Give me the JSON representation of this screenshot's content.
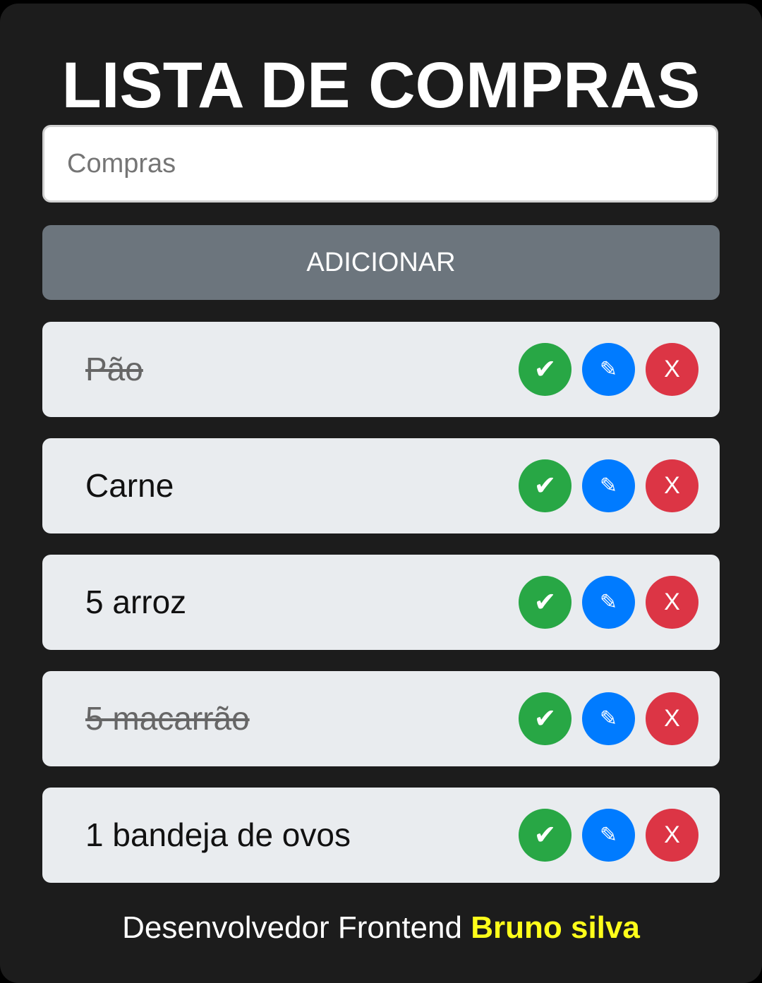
{
  "header": {
    "title": "LISTA DE COMPRAS"
  },
  "form": {
    "input_placeholder": "Compras",
    "input_value": "",
    "add_button_label": "ADICIONAR"
  },
  "items": [
    {
      "label": "Pão",
      "done": true
    },
    {
      "label": "Carne",
      "done": false
    },
    {
      "label": "5 arroz",
      "done": false
    },
    {
      "label": "5 macarrão",
      "done": true
    },
    {
      "label": "1 bandeja de ovos",
      "done": false
    }
  ],
  "item_actions": {
    "check_icon": "check-icon",
    "edit_icon": "pencil-icon",
    "delete_label": "X"
  },
  "footer": {
    "text": "Desenvolvedor Frontend",
    "author": "Bruno silva"
  },
  "colors": {
    "background": "#1c1c1c",
    "add_button": "#6c757d",
    "item_background": "#e9ecef",
    "check": "#28a745",
    "edit": "#007bff",
    "delete": "#dc3545",
    "author_highlight": "#ffff1a"
  }
}
